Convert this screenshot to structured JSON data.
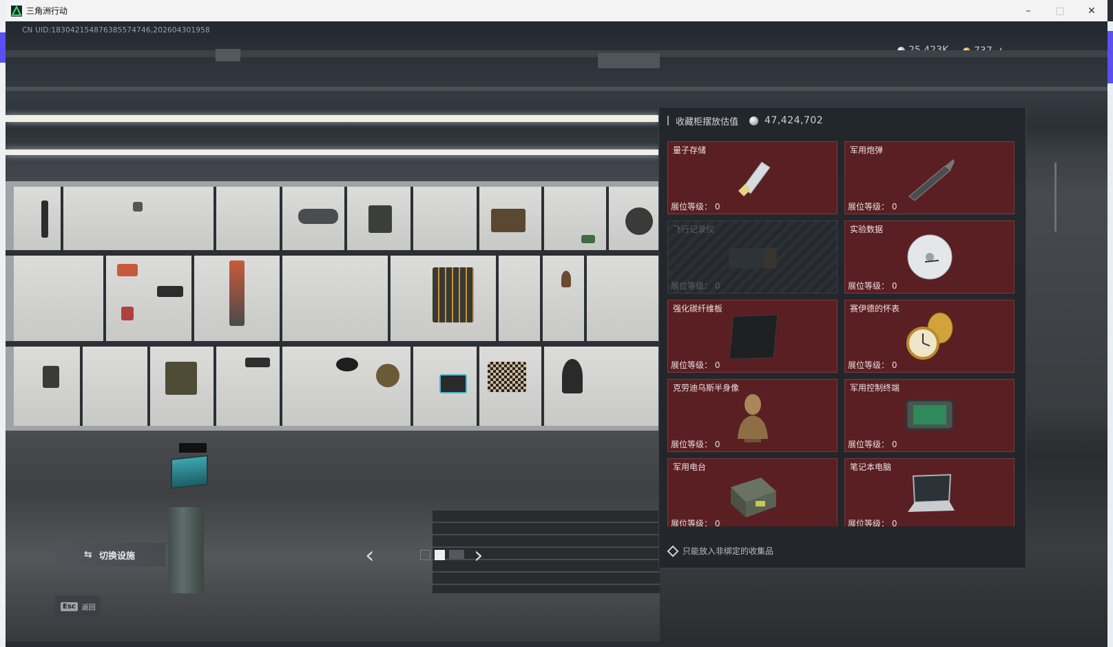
{
  "window": {
    "title": "三角洲行动",
    "controls": {
      "minimize": "–",
      "maximize": "□",
      "close": "✕"
    }
  },
  "hud": {
    "uid": "CN UID:18304215487638557474​6,202604301958",
    "currencies": [
      {
        "icon": "silver-coin-icon",
        "value": "25,423K"
      },
      {
        "icon": "gold-coin-icon",
        "value": "737"
      }
    ],
    "add_label": "+"
  },
  "panel": {
    "title": "收藏柜摆放估值",
    "value": "47,424,702",
    "items": [
      {
        "name": "量子存储",
        "level_label": "展位等级：",
        "level": "0",
        "locked": false,
        "icon": "usb-drive-icon"
      },
      {
        "name": "军用炮弹",
        "level_label": "展位等级：",
        "level": "0",
        "locked": false,
        "icon": "shell-icon"
      },
      {
        "name": "飞行记录仪",
        "level_label": "展位等级：",
        "level": "0",
        "locked": true,
        "icon": "flight-recorder-icon"
      },
      {
        "name": "实验数据",
        "level_label": "展位等级：",
        "level": "0",
        "locked": false,
        "icon": "disc-icon"
      },
      {
        "name": "强化碳纤维板",
        "level_label": "展位等级：",
        "level": "0",
        "locked": false,
        "icon": "carbon-plate-icon"
      },
      {
        "name": "赛伊德的怀表",
        "level_label": "展位等级：",
        "level": "0",
        "locked": false,
        "icon": "pocket-watch-icon"
      },
      {
        "name": "克劳迪乌斯半身像",
        "level_label": "展位等级：",
        "level": "0",
        "locked": false,
        "icon": "bust-icon"
      },
      {
        "name": "军用控制终端",
        "level_label": "展位等级：",
        "level": "0",
        "locked": false,
        "icon": "control-terminal-icon"
      },
      {
        "name": "军用电台",
        "level_label": "展位等级：",
        "level": "0",
        "locked": false,
        "icon": "radio-icon"
      },
      {
        "name": "笔记本电脑",
        "level_label": "展位等级：",
        "level": "0",
        "locked": false,
        "icon": "laptop-icon"
      }
    ],
    "footer_note": "只能放入非绑定的收集品"
  },
  "controls": {
    "switch_label": "切换设施",
    "prev": "‹",
    "next": "›",
    "esc_key": "Esc",
    "esc_label": "返回"
  },
  "colors": {
    "card_bg": "#5a1f22",
    "panel_bg": "#22262b",
    "accent_purple": "#5a4ff2"
  }
}
